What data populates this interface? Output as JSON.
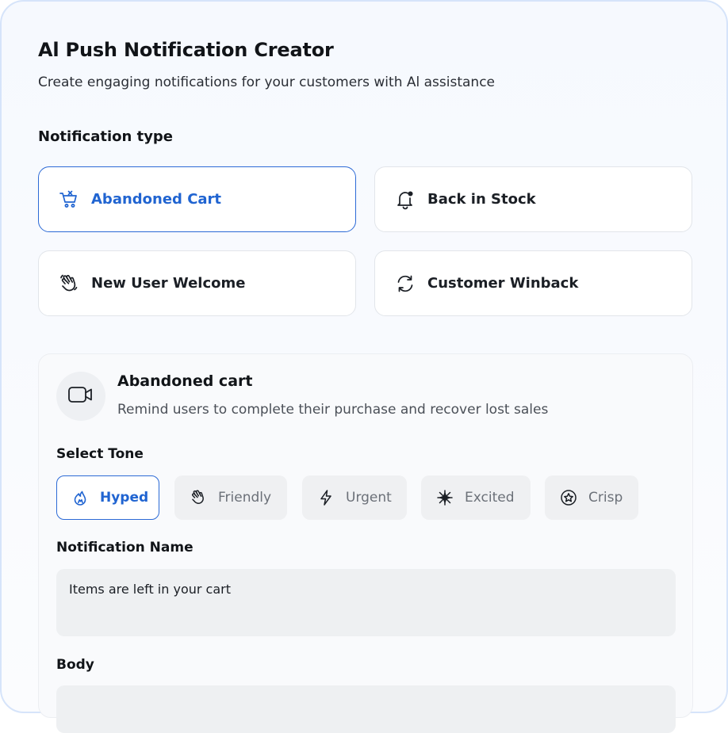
{
  "header": {
    "title": "Al Push Notification Creator",
    "subtitle": "Create engaging notifications for your customers with Al assistance"
  },
  "notification_type": {
    "label": "Notification type",
    "options": [
      {
        "label": "Abandoned Cart",
        "icon": "cart-x-icon",
        "selected": true
      },
      {
        "label": "Back in Stock",
        "icon": "bell-icon",
        "selected": false
      },
      {
        "label": "New User Welcome",
        "icon": "wave-hand-icon",
        "selected": false
      },
      {
        "label": "Customer Winback",
        "icon": "refresh-icon",
        "selected": false
      }
    ]
  },
  "detail": {
    "icon": "video-camera-icon",
    "title": "Abandoned cart",
    "description": "Remind users to complete their purchase and recover lost sales"
  },
  "tone": {
    "label": "Select Tone",
    "options": [
      {
        "label": "Hyped",
        "icon": "flame-icon",
        "selected": true
      },
      {
        "label": "Friendly",
        "icon": "hand-icon",
        "selected": false
      },
      {
        "label": "Urgent",
        "icon": "lightning-icon",
        "selected": false
      },
      {
        "label": "Excited",
        "icon": "sparkle-icon",
        "selected": false
      },
      {
        "label": "Crisp",
        "icon": "star-circle-icon",
        "selected": false
      }
    ]
  },
  "notification_name": {
    "label": "Notification Name",
    "value": "Items are left in your cart"
  },
  "body": {
    "label": "Body"
  },
  "colors": {
    "accent": "#2064d1",
    "panel_border": "#d6e4fa"
  }
}
